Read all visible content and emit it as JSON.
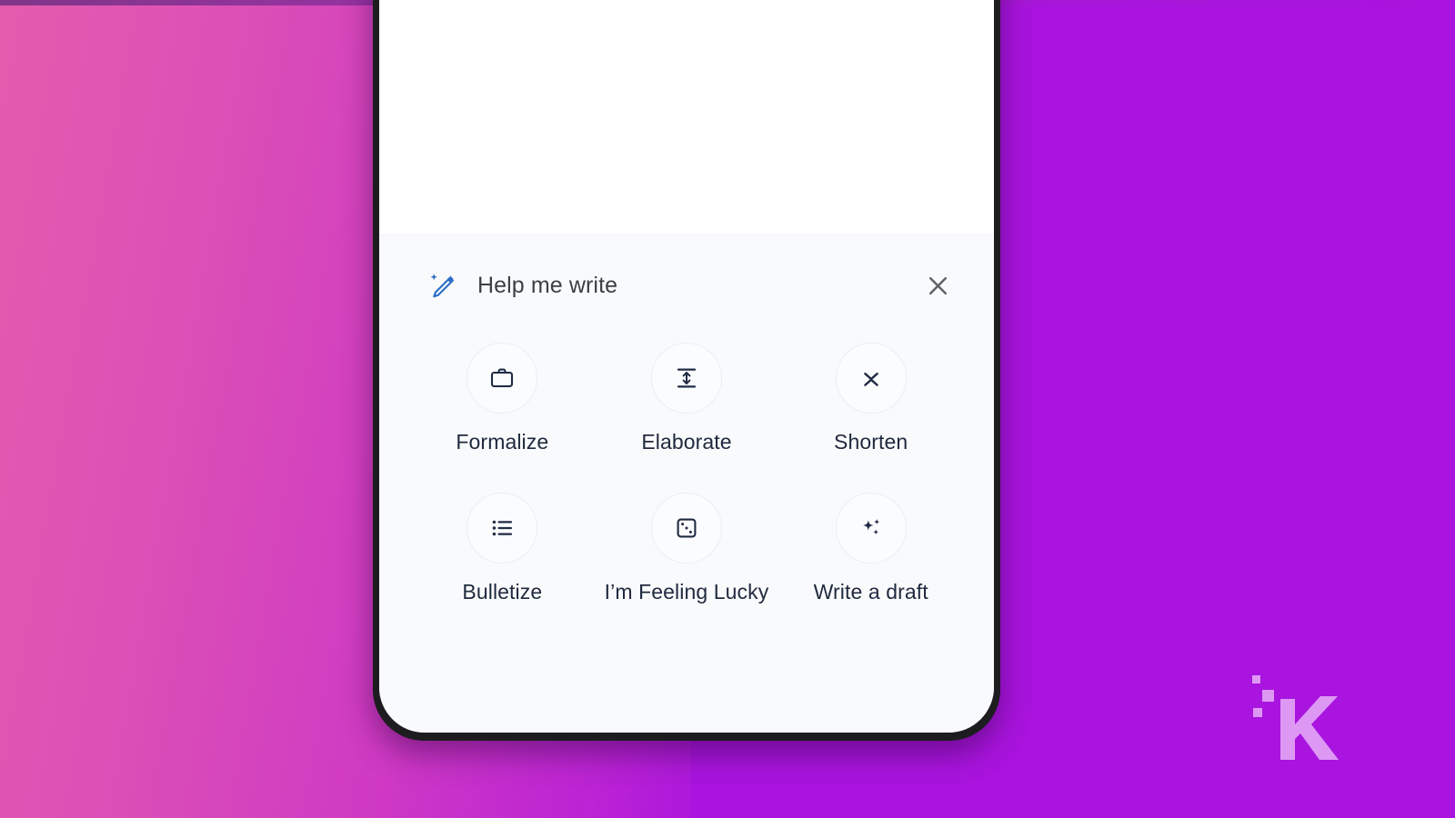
{
  "background": {
    "left_gradient_start": "#e45cae",
    "left_gradient_end": "#ad18db",
    "right_solid": "#a914de"
  },
  "device": {
    "frame_color": "#1d1d1f",
    "screen_color": "#ffffff"
  },
  "sheet": {
    "background": "#f9fafb",
    "header": {
      "icon_name": "magic-pencil-icon",
      "icon_color": "#2a6cc7",
      "title": "Help me write",
      "close_label": "Close",
      "close_icon_name": "close-icon"
    },
    "options": [
      {
        "id": "formalize",
        "label": "Formalize",
        "icon": "briefcase-icon"
      },
      {
        "id": "elaborate",
        "label": "Elaborate",
        "icon": "expand-vertical-icon"
      },
      {
        "id": "shorten",
        "label": "Shorten",
        "icon": "collapse-vertical-icon"
      },
      {
        "id": "bulletize",
        "label": "Bulletize",
        "icon": "bulleted-list-icon"
      },
      {
        "id": "lucky",
        "label": "I’m Feeling Lucky",
        "icon": "dice-icon"
      },
      {
        "id": "draft",
        "label": "Write a draft",
        "icon": "sparkles-icon"
      }
    ],
    "option_icon_color": "#1f2a44",
    "option_label_color": "#202a3f"
  },
  "watermark": {
    "name": "knowtechie-k-logo",
    "letter": "K",
    "color": "#e2a4f6"
  }
}
